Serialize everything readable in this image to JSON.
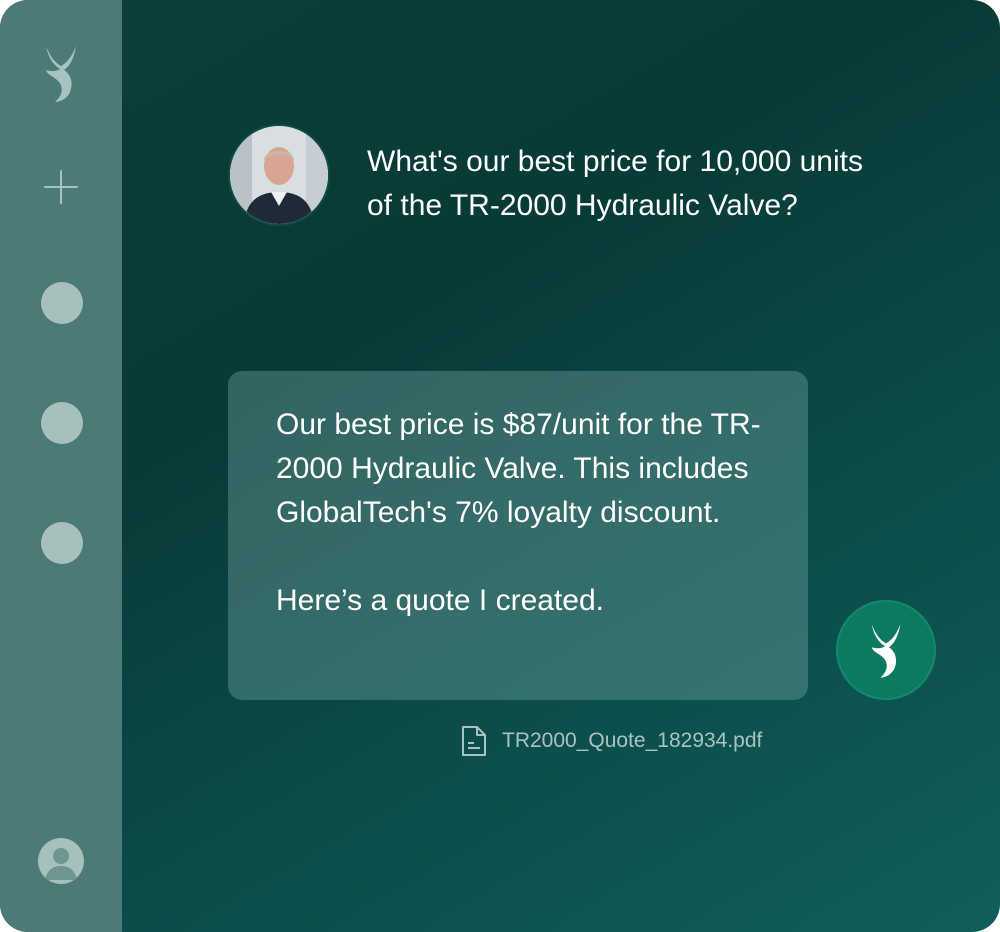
{
  "sidebar": {
    "logo_icon": "brand-logo-icon",
    "new_chat_icon": "plus-icon",
    "items": [
      "history-item",
      "history-item",
      "history-item"
    ],
    "profile_icon": "user-icon"
  },
  "conversation": {
    "user_message": "What's our best price for 10,000 units of the TR-2000 Hydraulic Valve?",
    "assistant_reply_paragraph_1": "Our best price is $87/unit for the TR-2000 Hydraulic Valve. This includes GlobalTech's 7% loyalty discount.",
    "assistant_reply_paragraph_2": "Here’s a quote I created.",
    "attachment_name": "TR2000_Quote_182934.pdf"
  },
  "colors": {
    "background": "#083a37",
    "sidebar": "#4b7a77",
    "bot_avatar": "#0b7a61",
    "muted_text": "#a8c4c2"
  }
}
